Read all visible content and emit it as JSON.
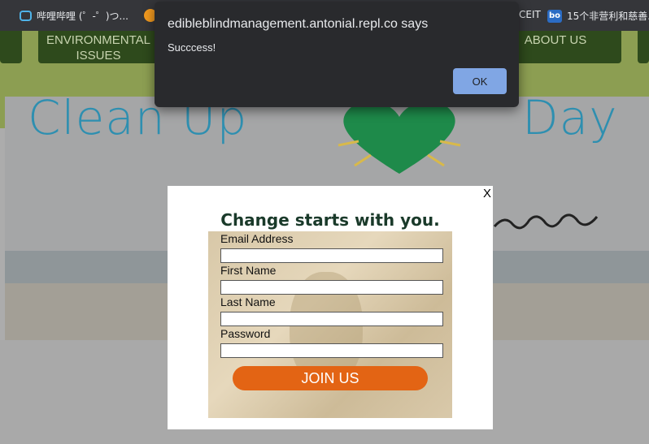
{
  "browser": {
    "bookmarks": [
      {
        "label": "哔哩哔哩 (゜-゜)つ...",
        "icon": "bilibili-icon"
      },
      {
        "label": "",
        "icon": "orange-circle-icon"
      },
      {
        "label": "CEIT",
        "icon": ""
      },
      {
        "label": "15个非营利和慈善...",
        "icon": "bo-icon"
      }
    ],
    "bo_icon_text": "bo"
  },
  "site": {
    "nav": [
      {
        "label": "ENVIRONMENTAL ISSUES"
      },
      {
        "label": "ABOUT US"
      }
    ],
    "hero_title_left": "Clean Up",
    "hero_title_right": "Day"
  },
  "alert": {
    "title": "edibleblindmanagement.antonial.repl.co says",
    "message": "Succcess!",
    "ok_label": "OK"
  },
  "modal": {
    "close_label": "X",
    "heading": "Change starts with you.",
    "fields": [
      {
        "label": "Email Address",
        "value": ""
      },
      {
        "label": "First Name",
        "value": ""
      },
      {
        "label": "Last Name",
        "value": ""
      },
      {
        "label": "Password",
        "value": ""
      }
    ],
    "submit_label": "JOIN US"
  },
  "colors": {
    "nav_bg": "#2e4a1c",
    "join_button": "#e36414",
    "alert_ok": "#8ab4f8"
  }
}
